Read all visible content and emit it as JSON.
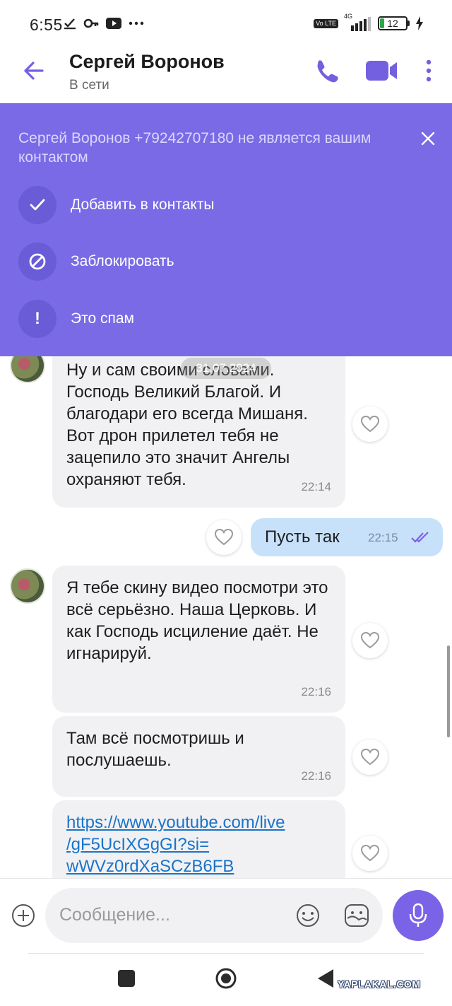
{
  "status_bar": {
    "time": "6:55",
    "network": "4G",
    "volte": "Vo LTE",
    "battery": "12"
  },
  "header": {
    "name": "Сергей Воронов",
    "status": "В сети"
  },
  "banner": {
    "text": "Сергей Воронов +79242707180 не является вашим контактом",
    "actions": [
      {
        "label": "Добавить в контакты",
        "icon": "check-icon"
      },
      {
        "label": "Заблокировать",
        "icon": "block-icon"
      },
      {
        "label": "Это спам",
        "icon": "exclamation-icon"
      }
    ]
  },
  "chat": {
    "date": "31.07.2024",
    "messages": [
      {
        "direction": "in",
        "text": "Ну и сам своими словами. Господь Великий Благой. И благодари его всегда Мишаня. Вот дрон прилетел тебя не зацепило это значит Ангелы охраняют тебя.",
        "time": "22:14"
      },
      {
        "direction": "out",
        "text": "Пусть так",
        "time": "22:15"
      },
      {
        "direction": "in",
        "text": "Я тебе скину видео посмотри это всё серьёзно. Наша Церковь. И как Господь исциление даёт. Не игнарируй.",
        "time": "22:16"
      },
      {
        "direction": "in",
        "text": "Там всё посмотришь и послушаешь.",
        "time": "22:16"
      },
      {
        "direction": "in",
        "text": "https://www.youtube.com/live/gF5UcIXGgGI?si=wWVz0rdXaSCzB6FB",
        "link_lines": [
          "https://www.youtube.com/live",
          "/gF5UcIXGgGI?si=",
          "wWVz0rdXaSCzB6FB"
        ]
      }
    ]
  },
  "composer": {
    "placeholder": "Сообщение..."
  },
  "watermark": "YAPLAKAL.COM",
  "colors": {
    "accent": "#7b63e8",
    "banner": "#7a6ae6",
    "outgoing_bubble": "#c8e1fb",
    "incoming_bubble": "#f1f1f3",
    "link": "#1a73c9"
  }
}
